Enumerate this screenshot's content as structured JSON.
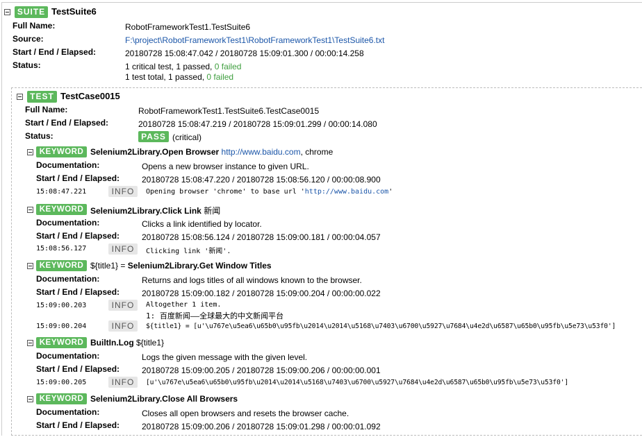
{
  "suite": {
    "badge": "SUITE",
    "name": "TestSuite6",
    "full_name_label": "Full Name:",
    "full_name": "RobotFrameworkTest1.TestSuite6",
    "source_label": "Source:",
    "source": "F:\\project\\RobotFrameworkTest1\\RobotFrameworkTest1\\TestSuite6.txt",
    "times_label": "Start / End / Elapsed:",
    "times": "20180728 15:08:47.042 / 20180728 15:09:01.300 / 00:00:14.258",
    "status_label": "Status:",
    "status_line1_prefix": "1 critical test, 1 passed, ",
    "status_line1_failed": "0 failed",
    "status_line2_prefix": "1 test total, 1 passed, ",
    "status_line2_failed": "0 failed"
  },
  "test": {
    "badge": "TEST",
    "name": "TestCase0015",
    "full_name_label": "Full Name:",
    "full_name": "RobotFrameworkTest1.TestSuite6.TestCase0015",
    "times_label": "Start / End / Elapsed:",
    "times": "20180728 15:08:47.219 / 20180728 15:09:01.299 / 00:00:14.080",
    "status_label": "Status:",
    "status_badge": "PASS",
    "status_note": "(critical)"
  },
  "keywords": [
    {
      "badge": "KEYWORD",
      "assign": "",
      "library": "Selenium2Library",
      "name": ".Open Browser",
      "arg_link": "http://www.baidu.com",
      "args": ", chrome",
      "doc_label": "Documentation:",
      "doc": "Opens a new browser instance to given URL.",
      "times_label": "Start / End / Elapsed:",
      "times": "20180728 15:08:47.220 / 20180728 15:08:56.120 / 00:00:08.900",
      "messages": [
        {
          "time": "15:08:47.221",
          "level": "INFO",
          "text": "Opening browser 'chrome' to base url '",
          "link": "http://www.baidu.com",
          "suffix": "'"
        }
      ]
    },
    {
      "badge": "KEYWORD",
      "assign": "",
      "library": "Selenium2Library",
      "name": ".Click Link",
      "args": " 新闻",
      "doc_label": "Documentation:",
      "doc": "Clicks a link identified by locator.",
      "times_label": "Start / End / Elapsed:",
      "times": "20180728 15:08:56.124 / 20180728 15:09:00.181 / 00:00:04.057",
      "messages": [
        {
          "time": "15:08:56.127",
          "level": "INFO",
          "text": "Clicking link '新闻'."
        }
      ]
    },
    {
      "badge": "KEYWORD",
      "assign": "${title1} = ",
      "library": "Selenium2Library",
      "name": ".Get Window Titles",
      "args": "",
      "doc_label": "Documentation:",
      "doc": "Returns and logs titles of all windows known to the browser.",
      "times_label": "Start / End / Elapsed:",
      "times": "20180728 15:09:00.182 / 20180728 15:09:00.204 / 00:00:00.022",
      "messages": [
        {
          "time": "15:09:00.203",
          "level": "INFO",
          "text": "Altogether 1 item.",
          "line2": "1: 百度新闻——全球最大的中文新闻平台"
        },
        {
          "time": "15:09:00.204",
          "level": "INFO",
          "text": "${title1} = [u'\\u767e\\u5ea6\\u65b0\\u95fb\\u2014\\u2014\\u5168\\u7403\\u6700\\u5927\\u7684\\u4e2d\\u6587\\u65b0\\u95fb\\u5e73\\u53f0']"
        }
      ]
    },
    {
      "badge": "KEYWORD",
      "assign": "",
      "library": "BuiltIn",
      "name": ".Log",
      "args": " ${title1}",
      "doc_label": "Documentation:",
      "doc": "Logs the given message with the given level.",
      "times_label": "Start / End / Elapsed:",
      "times": "20180728 15:09:00.205 / 20180728 15:09:00.206 / 00:00:00.001",
      "messages": [
        {
          "time": "15:09:00.205",
          "level": "INFO",
          "text": "[u'\\u767e\\u5ea6\\u65b0\\u95fb\\u2014\\u2014\\u5168\\u7403\\u6700\\u5927\\u7684\\u4e2d\\u6587\\u65b0\\u95fb\\u5e73\\u53f0']"
        }
      ]
    },
    {
      "badge": "KEYWORD",
      "assign": "",
      "library": "Selenium2Library",
      "name": ".Close All Browsers",
      "args": "",
      "doc_label": "Documentation:",
      "doc": "Closes all open browsers and resets the browser cache.",
      "times_label": "Start / End / Elapsed:",
      "times": "20180728 15:09:00.206 / 20180728 15:09:01.298 / 00:00:01.092",
      "messages": []
    }
  ]
}
